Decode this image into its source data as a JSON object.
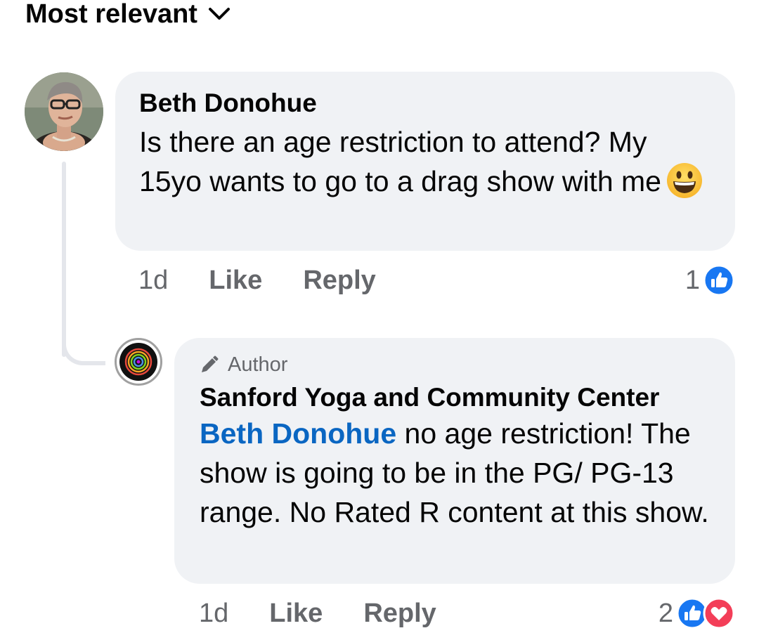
{
  "sort": {
    "label": "Most relevant",
    "icon": "chevron-down-icon"
  },
  "comments": [
    {
      "author": "Beth Donohue",
      "text": "Is there an age restriction to attend? My 15yo wants to go to a drag show with me",
      "emoji": "grinning-face-emoji",
      "time": "1d",
      "like_label": "Like",
      "reply_label": "Reply",
      "reaction_count": "1",
      "reactions": [
        "like"
      ]
    },
    {
      "badge": "Author",
      "author": "Sanford Yoga and Community Center",
      "mention": "Beth Donohue",
      "text": " no age restriction! The show is going to be in the PG/ PG-13 range. No Rated R content at this show.",
      "time": "1d",
      "like_label": "Like",
      "reply_label": "Reply",
      "reaction_count": "2",
      "reactions": [
        "like",
        "love"
      ]
    }
  ],
  "colors": {
    "bubble": "#f0f2f5",
    "mention": "#0a66c2",
    "like_blue": "#1877f2",
    "love_red": "#f33e58",
    "secondary_text": "#65676b"
  }
}
